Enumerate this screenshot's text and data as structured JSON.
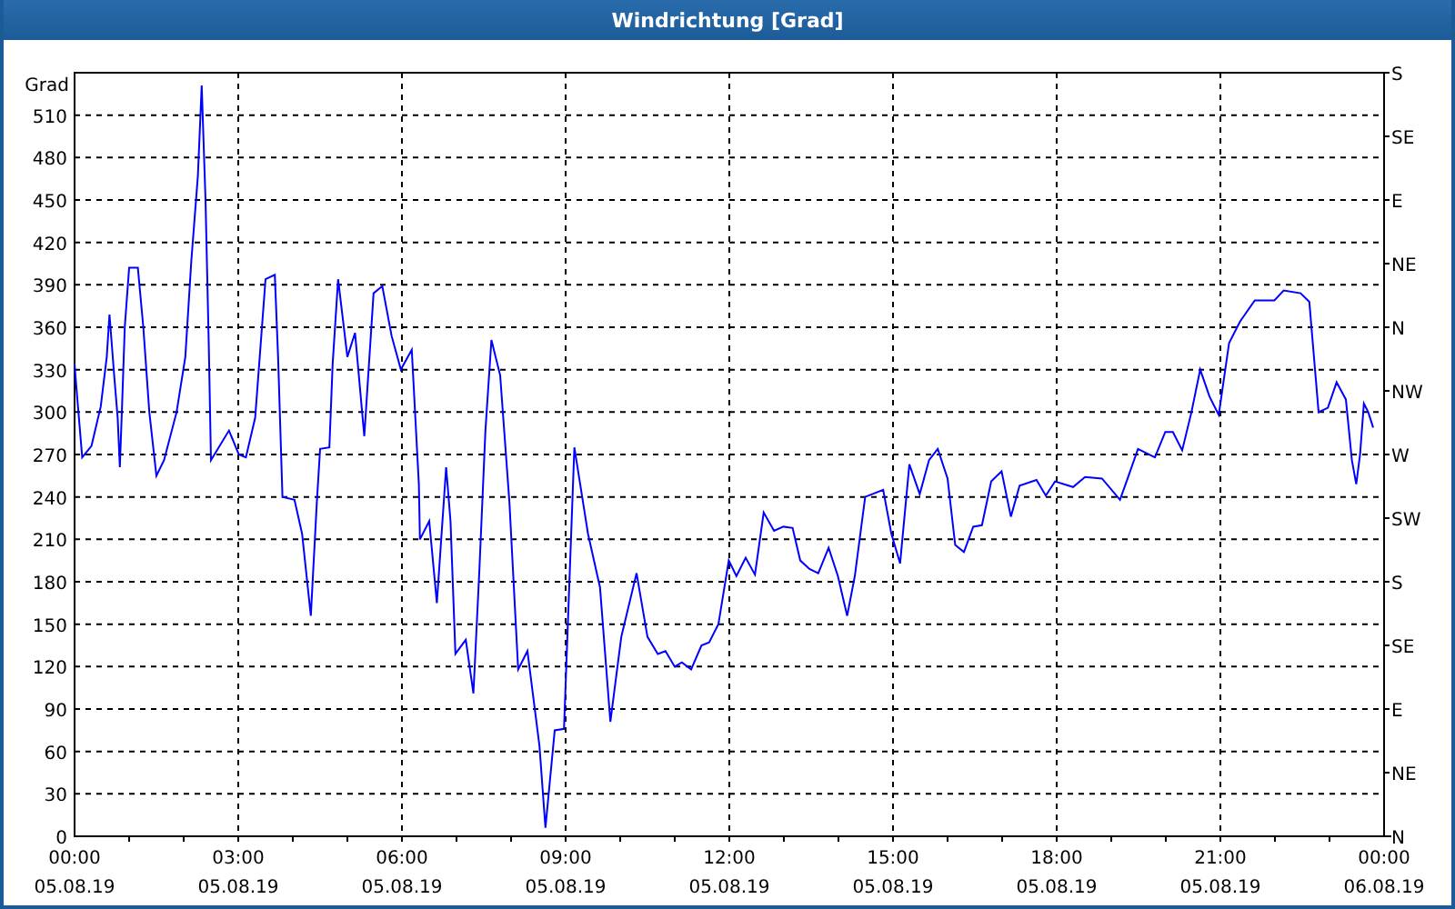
{
  "window": {
    "title": "Windrichtung [Grad]"
  },
  "chart": {
    "chart_data": {
      "type": "line",
      "grid": true,
      "ylabel": "Grad",
      "xlim": [
        0,
        24
      ],
      "ylim": [
        0,
        540
      ],
      "yticks": [
        {
          "value": 0,
          "label": "0"
        },
        {
          "value": 30,
          "label": "30"
        },
        {
          "value": 60,
          "label": "60"
        },
        {
          "value": 90,
          "label": "90"
        },
        {
          "value": 120,
          "label": "120"
        },
        {
          "value": 150,
          "label": "150"
        },
        {
          "value": 180,
          "label": "180"
        },
        {
          "value": 210,
          "label": "210"
        },
        {
          "value": 240,
          "label": "240"
        },
        {
          "value": 270,
          "label": "270"
        },
        {
          "value": 300,
          "label": "300"
        },
        {
          "value": 330,
          "label": "330"
        },
        {
          "value": 360,
          "label": "360"
        },
        {
          "value": 390,
          "label": "390"
        },
        {
          "value": 420,
          "label": "420"
        },
        {
          "value": 450,
          "label": "450"
        },
        {
          "value": 480,
          "label": "480"
        },
        {
          "value": 510,
          "label": "510"
        }
      ],
      "xticks": [
        {
          "value": 0,
          "label": "00:00"
        },
        {
          "value": 3,
          "label": "03:00"
        },
        {
          "value": 6,
          "label": "06:00"
        },
        {
          "value": 9,
          "label": "09:00"
        },
        {
          "value": 12,
          "label": "12:00"
        },
        {
          "value": 15,
          "label": "15:00"
        },
        {
          "value": 18,
          "label": "18:00"
        },
        {
          "value": 21,
          "label": "21:00"
        },
        {
          "value": 24,
          "label": "00:00"
        }
      ],
      "x": [
        0,
        0.03,
        0.14,
        0.31,
        0.48,
        0.59,
        0.64,
        0.73,
        0.79,
        0.83,
        0.87,
        0.92,
        1.0,
        1.16,
        1.26,
        1.37,
        1.5,
        1.64,
        1.87,
        2.03,
        2.14,
        2.26,
        2.33,
        2.4,
        2.46,
        2.5,
        2.83,
        3.01,
        3.14,
        3.31,
        3.5,
        3.67,
        3.73,
        3.81,
        4.03,
        4.17,
        4.33,
        4.44,
        4.5,
        4.67,
        4.73,
        4.83,
        5.0,
        5.14,
        5.31,
        5.48,
        5.64,
        5.81,
        5.98,
        6.18,
        6.31,
        6.33,
        6.5,
        6.64,
        6.81,
        6.89,
        6.98,
        7.17,
        7.31,
        7.42,
        7.53,
        7.64,
        7.8,
        7.97,
        8.13,
        8.3,
        8.52,
        8.63,
        8.8,
        8.97,
        9.16,
        9.41,
        9.63,
        9.82,
        10.02,
        10.3,
        10.5,
        10.69,
        10.83,
        11.0,
        11.13,
        11.3,
        11.49,
        11.63,
        11.8,
        11.99,
        12.13,
        12.3,
        12.47,
        12.63,
        12.82,
        12.99,
        13.16,
        13.3,
        13.47,
        13.63,
        13.82,
        13.99,
        14.16,
        14.3,
        14.49,
        14.82,
        14.97,
        15.13,
        15.3,
        15.49,
        15.66,
        15.82,
        16.0,
        16.14,
        16.3,
        16.47,
        16.63,
        16.8,
        16.99,
        17.16,
        17.32,
        17.63,
        17.8,
        17.97,
        18.3,
        18.52,
        18.83,
        19.16,
        19.3,
        19.49,
        19.8,
        19.99,
        20.13,
        20.3,
        20.47,
        20.63,
        20.8,
        20.97,
        21.16,
        21.36,
        21.63,
        21.99,
        22.16,
        22.47,
        22.63,
        22.8,
        22.97,
        23.13,
        23.3,
        23.41,
        23.49,
        23.56,
        23.63,
        23.71,
        23.8
      ],
      "series": [
        {
          "color": "#0000ff",
          "values": [
            334,
            319,
            268,
            276,
            304,
            339,
            369,
            324,
            296,
            261,
            304,
            360,
            402,
            402,
            360,
            300,
            255,
            266,
            300,
            339,
            407,
            467,
            531,
            450,
            347,
            266,
            287,
            270,
            268,
            296,
            394,
            397,
            339,
            240,
            238,
            214,
            156,
            236,
            274,
            275,
            334,
            394,
            339,
            356,
            283,
            384,
            389,
            354,
            330,
            344,
            249,
            210,
            223,
            165,
            261,
            223,
            129,
            139,
            101,
            189,
            287,
            351,
            326,
            236,
            118,
            131,
            64,
            6,
            75,
            76,
            275,
            214,
            176,
            81,
            141,
            186,
            141,
            129,
            131,
            120,
            123,
            118,
            135,
            137,
            150,
            195,
            184,
            197,
            185,
            229,
            216,
            219,
            218,
            195,
            189,
            186,
            204,
            184,
            156,
            184,
            240,
            245,
            214,
            193,
            263,
            242,
            266,
            274,
            253,
            206,
            201,
            219,
            220,
            251,
            258,
            226,
            248,
            252,
            241,
            251,
            247,
            254,
            253,
            238,
            253,
            274,
            268,
            286,
            286,
            273,
            300,
            330,
            311,
            298,
            349,
            364,
            379,
            379,
            386,
            384,
            378,
            300,
            303,
            321,
            309,
            266,
            249,
            270,
            306,
            300,
            289
          ]
        }
      ]
    },
    "x_tick_dates": [
      "05.08.19",
      "05.08.19",
      "05.08.19",
      "05.08.19",
      "05.08.19",
      "05.08.19",
      "05.08.19",
      "05.08.19",
      "06.08.19"
    ],
    "right_axis_labels": [
      "S",
      "SE",
      "E",
      "NE",
      "N",
      "NW",
      "W",
      "SW",
      "S",
      "SE",
      "E",
      "NE",
      "N"
    ]
  }
}
